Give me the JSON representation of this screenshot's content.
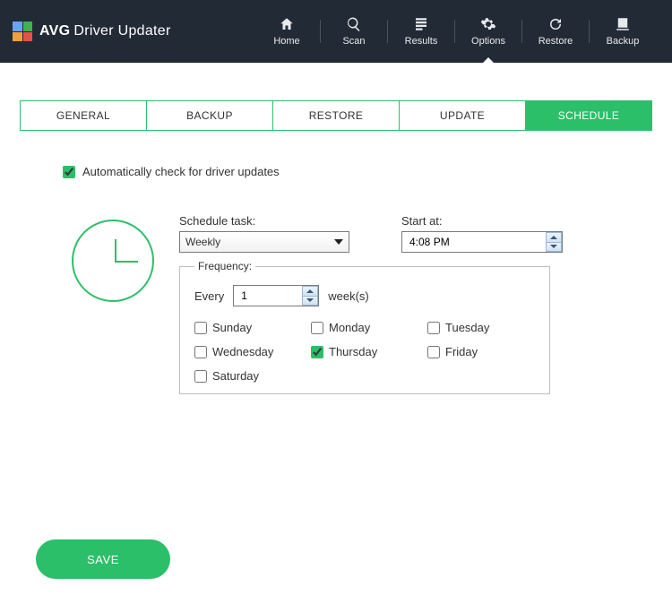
{
  "brand": {
    "bold": "AVG",
    "rest": "Driver Updater"
  },
  "nav": {
    "home": "Home",
    "scan": "Scan",
    "results": "Results",
    "options": "Options",
    "restore": "Restore",
    "backup": "Backup",
    "active": "options"
  },
  "tabs": {
    "general": "GENERAL",
    "backup": "BACKUP",
    "restore": "RESTORE",
    "update": "UPDATE",
    "schedule": "SCHEDULE",
    "active": "schedule"
  },
  "form": {
    "auto_check_label": "Automatically check for driver updates",
    "auto_check_checked": true,
    "schedule_task_label": "Schedule task:",
    "schedule_task_value": "Weekly",
    "start_at_label": "Start at:",
    "start_at_value": "4:08 PM",
    "frequency_legend": "Frequency:",
    "every_label": "Every",
    "every_value": "1",
    "every_unit": "week(s)",
    "days": {
      "sunday": {
        "label": "Sunday",
        "checked": false
      },
      "monday": {
        "label": "Monday",
        "checked": false
      },
      "tuesday": {
        "label": "Tuesday",
        "checked": false
      },
      "wednesday": {
        "label": "Wednesday",
        "checked": false
      },
      "thursday": {
        "label": "Thursday",
        "checked": true
      },
      "friday": {
        "label": "Friday",
        "checked": false
      },
      "saturday": {
        "label": "Saturday",
        "checked": false
      }
    }
  },
  "buttons": {
    "save": "SAVE"
  },
  "colors": {
    "accent": "#2bbf6a",
    "header": "#222b35"
  }
}
